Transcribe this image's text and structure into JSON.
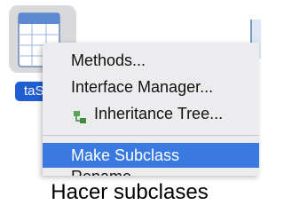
{
  "desktop": {
    "file_icon": "class-file-icon",
    "file_label": "taS"
  },
  "context_menu": {
    "items": [
      {
        "label": "Methods...",
        "icon": null
      },
      {
        "label": "Interface Manager...",
        "icon": null
      },
      {
        "label": "Inheritance Tree...",
        "icon": "inheritance-tree-icon"
      },
      {
        "label": "Make Subclass",
        "icon": null,
        "highlighted": true
      },
      {
        "label": "Rename",
        "icon": null
      }
    ]
  },
  "caption": "Hacer subclases",
  "colors": {
    "menu_background": "#ececee",
    "highlight": "#3a7ae0",
    "label_background": "#1f5fd1",
    "tile_background": "#d9d9dc"
  }
}
